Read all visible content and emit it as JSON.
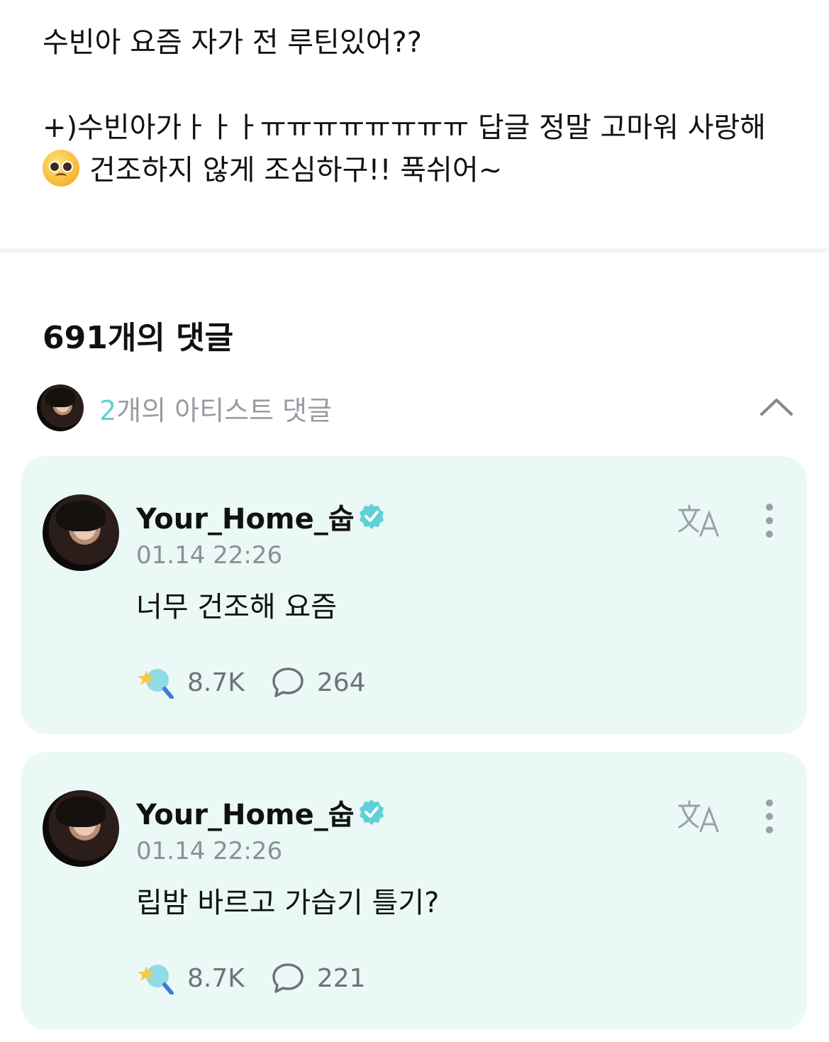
{
  "post": {
    "line1": "수빈아 요즘 자가 전 루틴있어??",
    "line2": "+)수빈아가ㅏㅏㅏㅠㅠㅠㅠㅠㅠㅠㅠ 답글 정말 고마워 사랑해",
    "line3": "건조하지 않게 조심하구!! 푹쉬어~",
    "emoji": "pleading-face"
  },
  "comments_section": {
    "count_label": "691개의 댓글",
    "artist_count": "2",
    "artist_label_suffix": "개의 아티스트 댓글",
    "accent_color": "#5fd0d6"
  },
  "comments": [
    {
      "author": "Your_Home_숩",
      "timestamp": "01.14 22:26",
      "text": "너무 건조해 요즘",
      "likes": "8.7K",
      "replies": "264"
    },
    {
      "author": "Your_Home_숩",
      "timestamp": "01.14 22:26",
      "text": "립밤 바르고 가습기 틀기?",
      "likes": "8.7K",
      "replies": "221"
    }
  ],
  "colors": {
    "card_bg": "#eaf8f6",
    "verified": "#5fd0d6",
    "muted_text": "#8d8f95"
  }
}
